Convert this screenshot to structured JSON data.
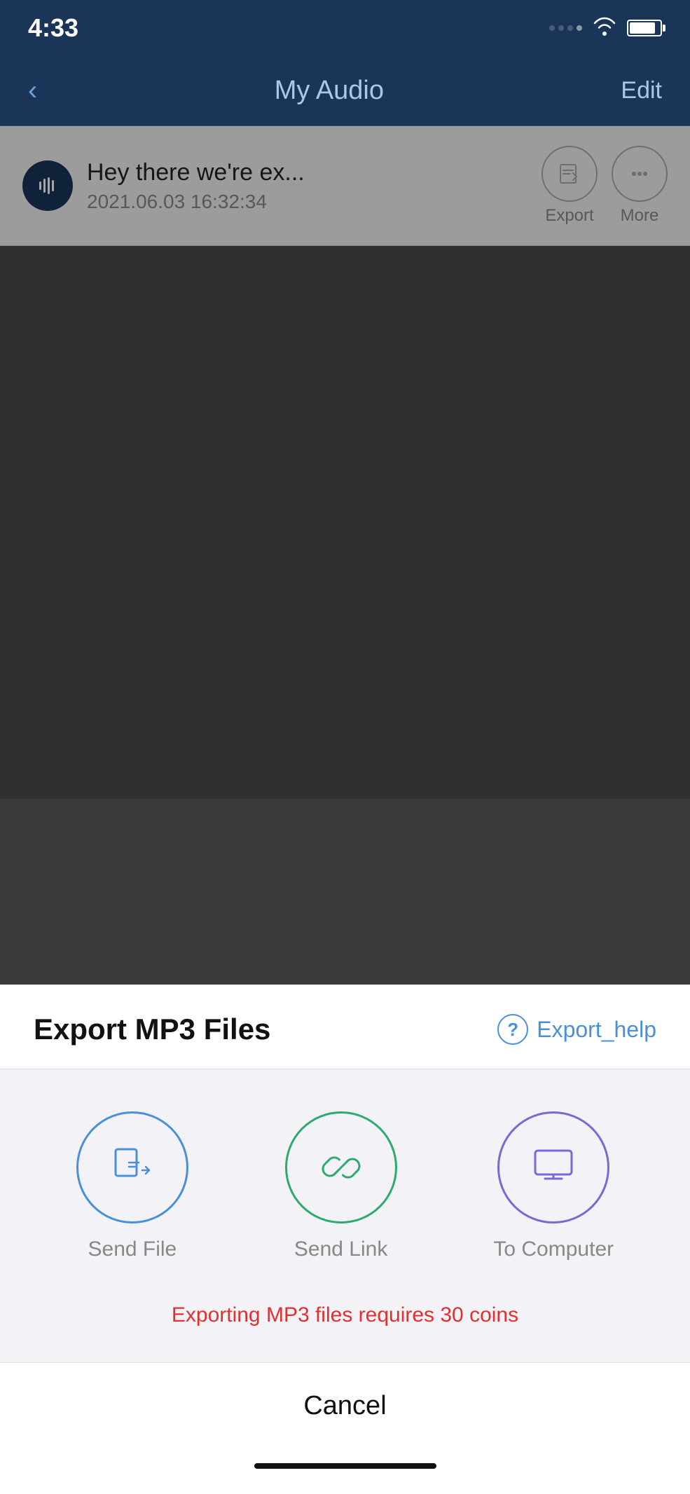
{
  "statusBar": {
    "time": "4:33",
    "dotColor": "#f5a623"
  },
  "navBar": {
    "backLabel": "‹",
    "title": "My Audio",
    "editLabel": "Edit"
  },
  "audioItem": {
    "title": "Hey there we're ex...",
    "date": "2021.06.03 16:32:34",
    "exportLabel": "Export",
    "moreLabel": "More"
  },
  "exportSheet": {
    "title": "Export MP3 Files",
    "helpLabel": "Export_help",
    "helpQuestion": "?",
    "options": [
      {
        "id": "send-file",
        "label": "Send File",
        "colorClass": "blue"
      },
      {
        "id": "send-link",
        "label": "Send Link",
        "colorClass": "green"
      },
      {
        "id": "to-computer",
        "label": "To Computer",
        "colorClass": "purple"
      }
    ],
    "coinsWarning": "Exporting MP3 files requires 30 coins",
    "cancelLabel": "Cancel"
  }
}
